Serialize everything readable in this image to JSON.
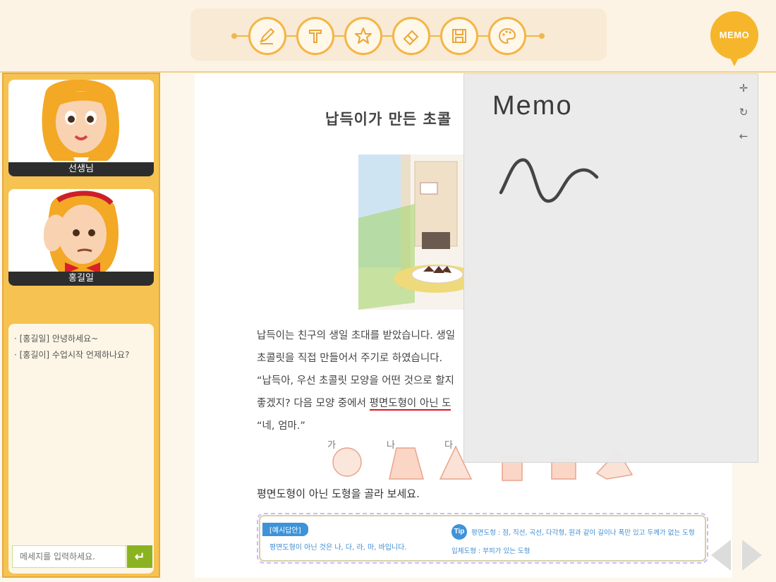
{
  "toolbar": {
    "tools": [
      "pencil-tool",
      "text-tool",
      "star-tool",
      "eraser-tool",
      "save-tool",
      "palette-tool"
    ]
  },
  "memo_badge": {
    "label": "MEMO"
  },
  "sidebar": {
    "teacher_name": "선생님",
    "student_name": "홍길일",
    "chat": {
      "messages": [
        "· [홍길일] 안녕하세요~",
        "· [홍길이] 수업시작 언제하나요?"
      ],
      "input_placeholder": "메세지를 입력하세요.",
      "send_label": "↵"
    }
  },
  "page": {
    "title": "납득이가 만든 초콜",
    "paragraph_1": "납득이는 친구의 생일 초대를 받았습니다. 생일",
    "paragraph_2": "초콜릿을 직접 만들어서 주기로 하였습니다.",
    "paragraph_3": "“납득아, 우선 초콜릿 모양을 어떤 것으로 할지",
    "paragraph_4_prefix": "좋겠지? 다음 모양 중에서 ",
    "paragraph_4_highlight": "평면도형이 아닌 도",
    "paragraph_5": "“네, 엄마.”",
    "shape_labels": [
      "가",
      "나",
      "다"
    ],
    "question": "평면도형이 아닌 도형을 골라 보세요.",
    "answer_tag": "[예시답안]",
    "answer_text": "평면도형이 아닌 것은 나, 다, 라, 마, 바입니다.",
    "tip_label": "Tip",
    "tip_plane": "평면도형 : 점, 직선, 곡선, 다각형, 원과 같이 길이나 폭만 있고 두께가 없는 도형",
    "tip_solid": "입체도형 : 부피가 있는 도형"
  },
  "memo": {
    "title": "Memo",
    "tools": {
      "move": "✛",
      "rotate": "↻",
      "back": "←"
    }
  },
  "colors": {
    "accent": "#f3b545",
    "sidebar": "#f6c251",
    "send_button": "#8bb321",
    "tip_blue": "#3e93d8",
    "underline_red": "#e3141d"
  }
}
